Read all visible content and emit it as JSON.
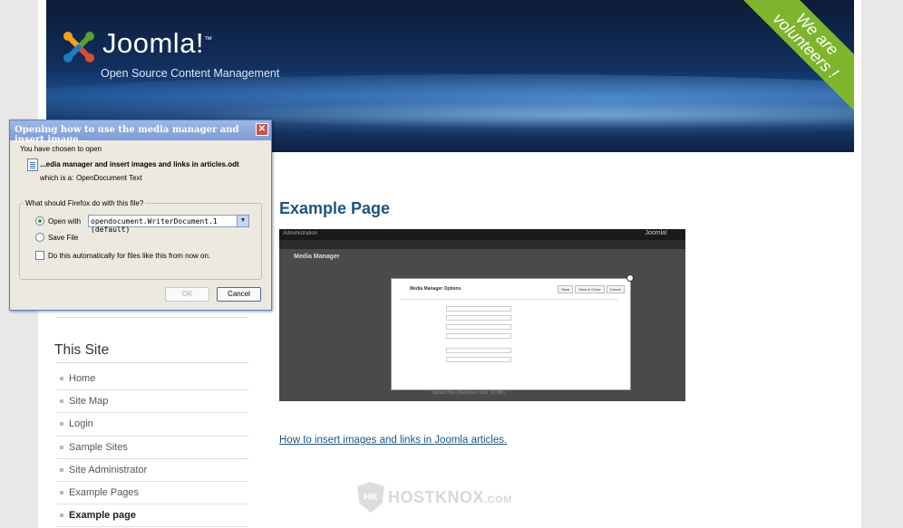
{
  "header": {
    "logo_text": "Joomla!",
    "logo_tm": "™",
    "tagline": "Open Source Content Management",
    "ribbon": "We are\nvolunteers !"
  },
  "sidebar": {
    "partial_item": "",
    "title": "This Site",
    "items": [
      {
        "label": "Home"
      },
      {
        "label": "Site Map"
      },
      {
        "label": "Login"
      },
      {
        "label": "Sample Sites"
      },
      {
        "label": "Site Administrator"
      },
      {
        "label": "Example Pages"
      },
      {
        "label": "Example page",
        "active": true
      }
    ]
  },
  "main": {
    "title": "Example Page",
    "screenshot": {
      "bar_title": "Administration",
      "bar_logo": "Joomla!",
      "heading": "Media Manager",
      "modal_title": "Media Manager Options",
      "modal_buttons": [
        "Save",
        "Save & Close",
        "Cancel"
      ],
      "footer": "Upload files (Maximum Size: 10 MB)"
    },
    "link_text": "How to insert images and links in Joomla articles."
  },
  "watermark": {
    "text": "HOSTKNOX",
    "suffix": ".COM",
    "badge": "HK"
  },
  "dialog": {
    "title": "Opening how to use the media manager and insert image...",
    "close": "✕",
    "chosen_label": "You have chosen to open",
    "filename": "...edia manager and insert images and links in articles.odt",
    "which_is": "which is a:",
    "file_type": "OpenDocument Text",
    "question": "What should Firefox do with this file?",
    "open_with_label": "Open with",
    "open_with_value": "opendocument.WriterDocument.1 (default)",
    "save_file_label": "Save File",
    "auto_label": "Do this automatically for files like this from now on.",
    "ok_label": "OK",
    "cancel_label": "Cancel"
  }
}
